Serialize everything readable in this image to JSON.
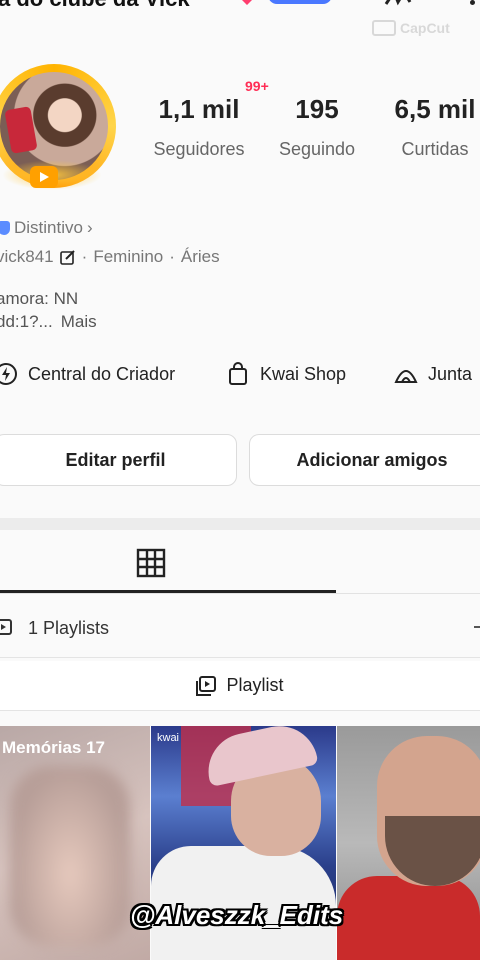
{
  "header": {
    "title_fragment": "a do clube da Vick",
    "capcut_watermark": "CapCut"
  },
  "profile": {
    "notification_count": "99+",
    "stats": [
      {
        "value": "1,1 mil",
        "label": "Seguidores"
      },
      {
        "value": "195",
        "label": "Seguindo"
      },
      {
        "value": "6,5 mil",
        "label": "Curtidas"
      }
    ],
    "badge_label": "Distintivo",
    "username": "vick841",
    "gender": "Feminino",
    "sign": "Áries",
    "bio_line1": "amora: NN",
    "bio_line2": "dd:1?...",
    "bio_more": "Mais"
  },
  "shortcuts": [
    {
      "label": "Central do Criador",
      "icon": "lightning-icon"
    },
    {
      "label": "Kwai Shop",
      "icon": "shopping-bag-icon"
    },
    {
      "label": "Junta",
      "icon": "tent-icon"
    }
  ],
  "actions": {
    "edit_profile": "Editar perfil",
    "add_friends": "Adicionar amigos"
  },
  "tabs": {
    "playlists_count_label": "1 Playlists",
    "playlist_label": "Playlist"
  },
  "thumbnails": [
    {
      "caption": "Memórias 17"
    },
    {
      "caption": "kwai"
    },
    {
      "caption": ""
    }
  ],
  "overlay": {
    "watermark": "@Alveszzk_Edits"
  },
  "colors": {
    "accent_red": "#ff2d55",
    "ring_gold": "#ffb300",
    "badge_blue": "#5b8cff"
  }
}
